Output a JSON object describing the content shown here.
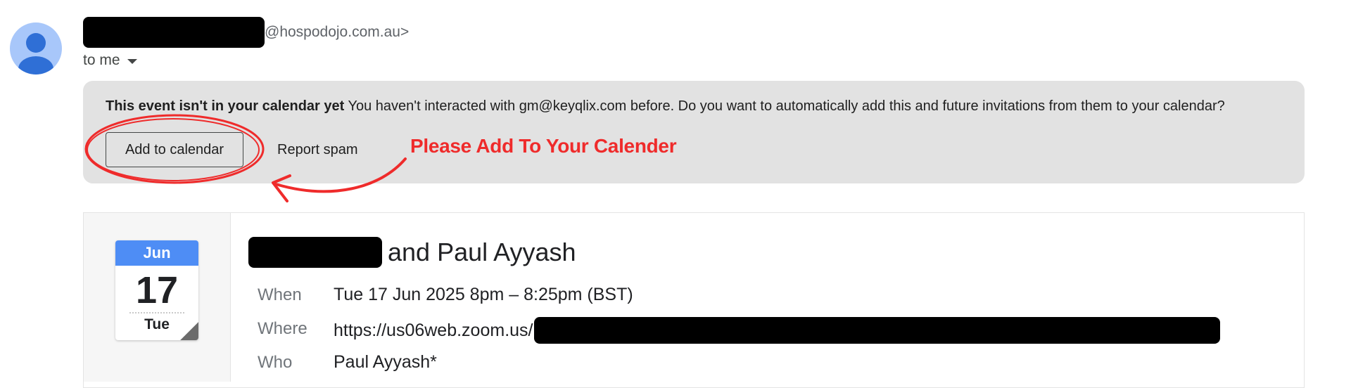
{
  "header": {
    "sender_suffix": "@hospodojo.com.au>",
    "recipient_label": "to me"
  },
  "banner": {
    "title": "This event isn't in your calendar yet",
    "message": "You haven't interacted with gm@keyqlix.com before. Do you want to automatically add this and future invitations from them to your calendar?",
    "add_button": "Add to calendar",
    "spam_button": "Report spam"
  },
  "annotation": {
    "text": "Please Add To Your Calender",
    "color": "#ef2b2b"
  },
  "calendar_icon": {
    "month": "Jun",
    "day": "17",
    "weekday": "Tue",
    "accent": "#4e8df5"
  },
  "event": {
    "title_suffix": "and Paul Ayyash",
    "when_label": "When",
    "when_value": "Tue 17 Jun 2025 8pm – 8:25pm (BST)",
    "where_label": "Where",
    "where_value": "https://us06web.zoom.us/",
    "who_label": "Who",
    "who_value": "Paul Ayyash*"
  },
  "icons": [
    "person-avatar-icon",
    "chevron-down-icon",
    "calendar-date-icon"
  ]
}
